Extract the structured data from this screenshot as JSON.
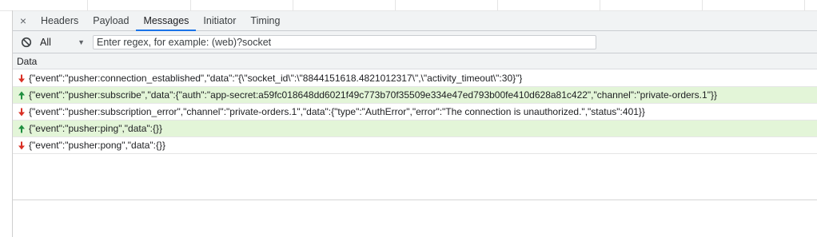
{
  "tabs": {
    "close_glyph": "×",
    "items": [
      {
        "label": "Headers"
      },
      {
        "label": "Payload"
      },
      {
        "label": "Messages",
        "active": true
      },
      {
        "label": "Initiator"
      },
      {
        "label": "Timing"
      }
    ]
  },
  "filter": {
    "clear_icon": "block-icon",
    "type_value": "All",
    "dropdown_arrow": "▼",
    "placeholder": "Enter regex, for example: (web)?socket"
  },
  "table": {
    "header": "Data",
    "rows": [
      {
        "direction": "received",
        "icon": "arrow-down-icon",
        "text": "{\"event\":\"pusher:connection_established\",\"data\":\"{\\\"socket_id\\\":\\\"8844151618.4821012317\\\",\\\"activity_timeout\\\":30}\"}"
      },
      {
        "direction": "sent",
        "icon": "arrow-up-icon",
        "text": "{\"event\":\"pusher:subscribe\",\"data\":{\"auth\":\"app-secret:a59fc018648dd6021f49c773b70f35509e334e47ed793b00fe410d628a81c422\",\"channel\":\"private-orders.1\"}}"
      },
      {
        "direction": "received",
        "icon": "arrow-down-icon",
        "text": "{\"event\":\"pusher:subscription_error\",\"channel\":\"private-orders.1\",\"data\":{\"type\":\"AuthError\",\"error\":\"The connection is unauthorized.\",\"status\":401}}"
      },
      {
        "direction": "sent",
        "icon": "arrow-up-icon",
        "text": "{\"event\":\"pusher:ping\",\"data\":{}}"
      },
      {
        "direction": "received",
        "icon": "arrow-down-icon",
        "text": "{\"event\":\"pusher:pong\",\"data\":{}}"
      }
    ]
  },
  "colors": {
    "accent": "#1a73e8",
    "sent_row_bg": "#e3f5d8",
    "received_arrow": "#d93025",
    "sent_arrow": "#1e8e3e"
  }
}
